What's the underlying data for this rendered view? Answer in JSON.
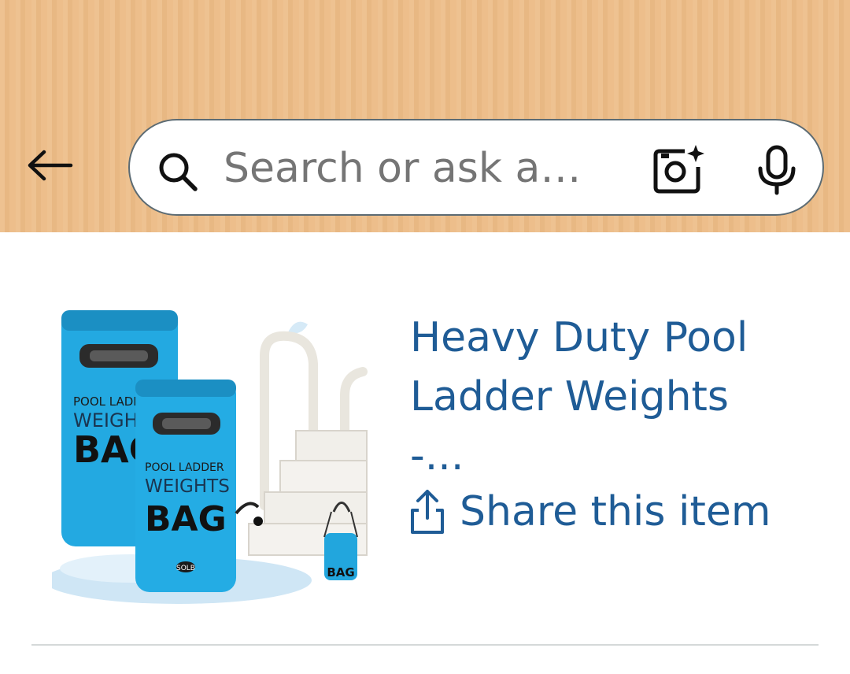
{
  "header": {
    "back_icon": "arrow-left-icon",
    "search": {
      "placeholder": "Search or ask a…",
      "value": ""
    },
    "camera_icon": "camera-search-icon",
    "mic_icon": "microphone-icon",
    "background_color": "#ecbb85"
  },
  "product": {
    "image_text": {
      "bag_line1": "POOL LADDER",
      "bag_line2": "WEIGHTS",
      "bag_line3": "BAG",
      "brand": "SOLB"
    },
    "title_line1": "Heavy Duty Pool",
    "title_line2": "Ladder Weights",
    "title_line3": "-...",
    "share_label": "Share this item",
    "share_icon": "share-icon",
    "link_color": "#1f5c96"
  }
}
